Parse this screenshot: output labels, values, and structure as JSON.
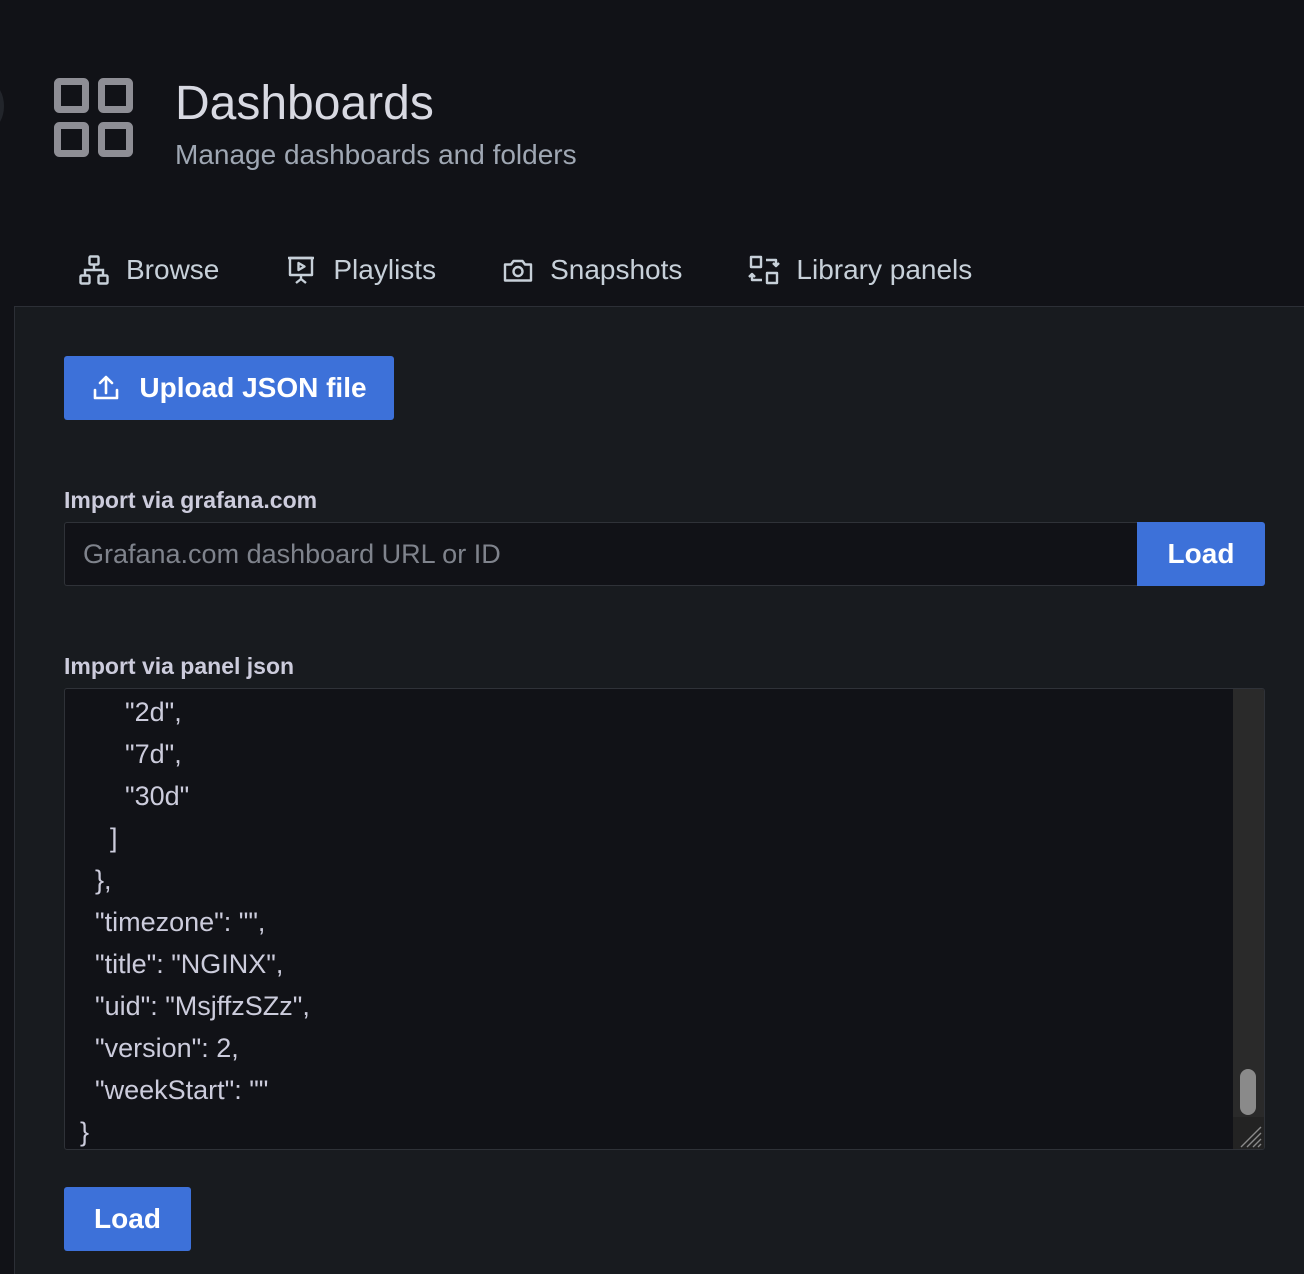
{
  "header": {
    "title": "Dashboards",
    "subtitle": "Manage dashboards and folders",
    "icon": "apps-grid-icon"
  },
  "tabs": [
    {
      "label": "Browse",
      "icon": "sitemap-icon"
    },
    {
      "label": "Playlists",
      "icon": "presentation-play-icon"
    },
    {
      "label": "Snapshots",
      "icon": "camera-icon"
    },
    {
      "label": "Library panels",
      "icon": "library-panel-icon"
    }
  ],
  "upload": {
    "label": "Upload JSON file",
    "icon": "upload-icon"
  },
  "grafana_import": {
    "label": "Import via grafana.com",
    "placeholder": "Grafana.com dashboard URL or ID",
    "value": "",
    "button_label": "Load"
  },
  "json_import": {
    "label": "Import via panel json",
    "lines": [
      "      \"2d\",",
      "      \"7d\",",
      "      \"30d\"",
      "    ]",
      "  },",
      "  \"timezone\": \"\",",
      "  \"title\": \"NGINX\",",
      "  \"uid\": \"MsjffzSZz\",",
      "  \"version\": 2,",
      "  \"weekStart\": \"\"",
      "}"
    ],
    "button_label": "Load"
  },
  "colors": {
    "background": "#111217",
    "panel": "#181b1f",
    "primary": "#3d71d9",
    "text": "#ccccdc"
  }
}
